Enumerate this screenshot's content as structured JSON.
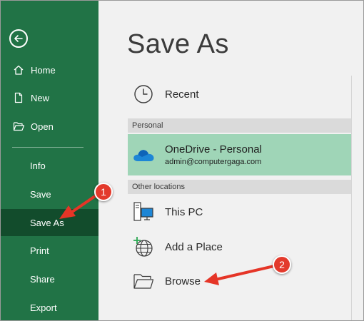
{
  "title": "Save As",
  "sidebar": {
    "items": [
      {
        "label": "Home",
        "icon": "home-icon"
      },
      {
        "label": "New",
        "icon": "new-document-icon"
      },
      {
        "label": "Open",
        "icon": "folder-open-icon"
      },
      {
        "label": "Info"
      },
      {
        "label": "Save"
      },
      {
        "label": "Save As",
        "selected": true
      },
      {
        "label": "Print"
      },
      {
        "label": "Share"
      },
      {
        "label": "Export"
      }
    ]
  },
  "locations": {
    "recent": {
      "label": "Recent",
      "icon": "clock-icon"
    },
    "personal_header": "Personal",
    "onedrive": {
      "name": "OneDrive - Personal",
      "email": "admin@computergaga.com",
      "icon": "onedrive-cloud-icon"
    },
    "other_header": "Other locations",
    "this_pc": {
      "label": "This PC",
      "icon": "computer-icon"
    },
    "add_place": {
      "label": "Add a Place",
      "icon": "globe-add-icon"
    },
    "browse": {
      "label": "Browse",
      "icon": "folder-icon"
    }
  },
  "annotations": {
    "badge1": "1",
    "badge2": "2"
  },
  "colors": {
    "sidebar": "#217346",
    "sidebar_selected": "#124c2c",
    "onedrive_bg": "#9fd5b7",
    "badge": "#e33a2c"
  }
}
